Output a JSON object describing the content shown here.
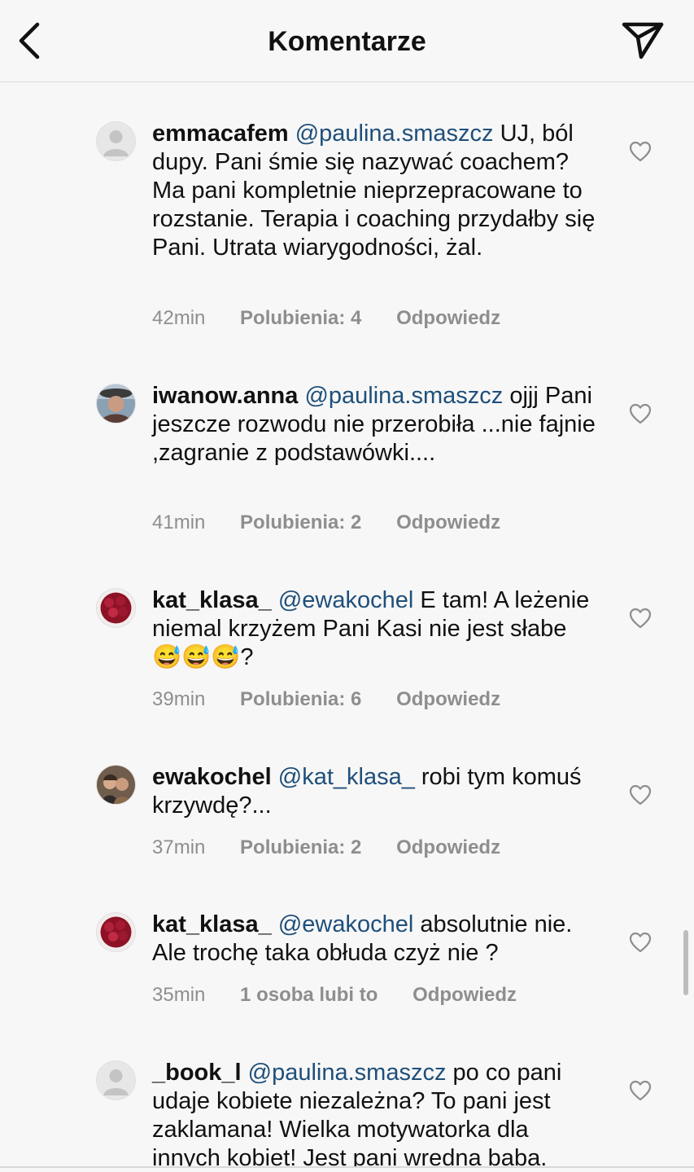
{
  "header": {
    "title": "Komentarze",
    "back_icon": "chevron-left-icon",
    "send_icon": "paper-plane-icon"
  },
  "comments": [
    {
      "username": "emmacafem",
      "mention": "@paulina.smaszcz",
      "text": " UJ, ból dupy. Pani śmie się nazywać coachem? Ma pani kompletnie nieprzepracowane to rozstanie. Terapia i coaching przydałby się Pani. Utrata wiarygodności, żal.",
      "time": "42min",
      "likes": "Polubienia: 4",
      "reply": "Odpowiedz",
      "avatar": "default-avatar-icon"
    },
    {
      "username": "iwanow.anna",
      "mention": "@paulina.smaszcz",
      "text": " ojjj Pani jeszcze rozwodu nie przerobiła ...nie fajnie ,zagranie z podstawówki....",
      "time": "41min",
      "likes": "Polubienia: 2",
      "reply": "Odpowiedz",
      "avatar": "photo-avatar-icon"
    },
    {
      "username": "kat_klasa_",
      "mention": "@ewakochel",
      "text": " E tam! A leżenie niemal krzyżem Pani Kasi nie jest słabe 😅😅😅?",
      "time": "39min",
      "likes": "Polubienia: 6",
      "reply": "Odpowiedz",
      "avatar": "raspberries-avatar-icon"
    },
    {
      "username": "ewakochel",
      "mention": "@kat_klasa_",
      "text": " robi tym komuś krzywdę?...",
      "time": "37min",
      "likes": "Polubienia: 2",
      "reply": "Odpowiedz",
      "avatar": "photo-avatar-icon"
    },
    {
      "username": "kat_klasa_",
      "mention": "@ewakochel",
      "text": " absolutnie nie. Ale trochę taka obłuda czyż nie ?",
      "time": "35min",
      "likes": "1 osoba lubi to",
      "reply": "Odpowiedz",
      "avatar": "raspberries-avatar-icon"
    },
    {
      "username": "_book_l",
      "mention": "@paulina.smaszcz",
      "text": " po co pani udaje kobiete niezależna? To pani jest zaklamana! Wielka motywatorka dla innych kobiet! Jest pani wredna baba.",
      "avatar": "default-avatar-icon"
    }
  ],
  "colors": {
    "background": "#f7f7f7",
    "mention": "#1f4f7a",
    "meta": "#8e8e8e"
  }
}
